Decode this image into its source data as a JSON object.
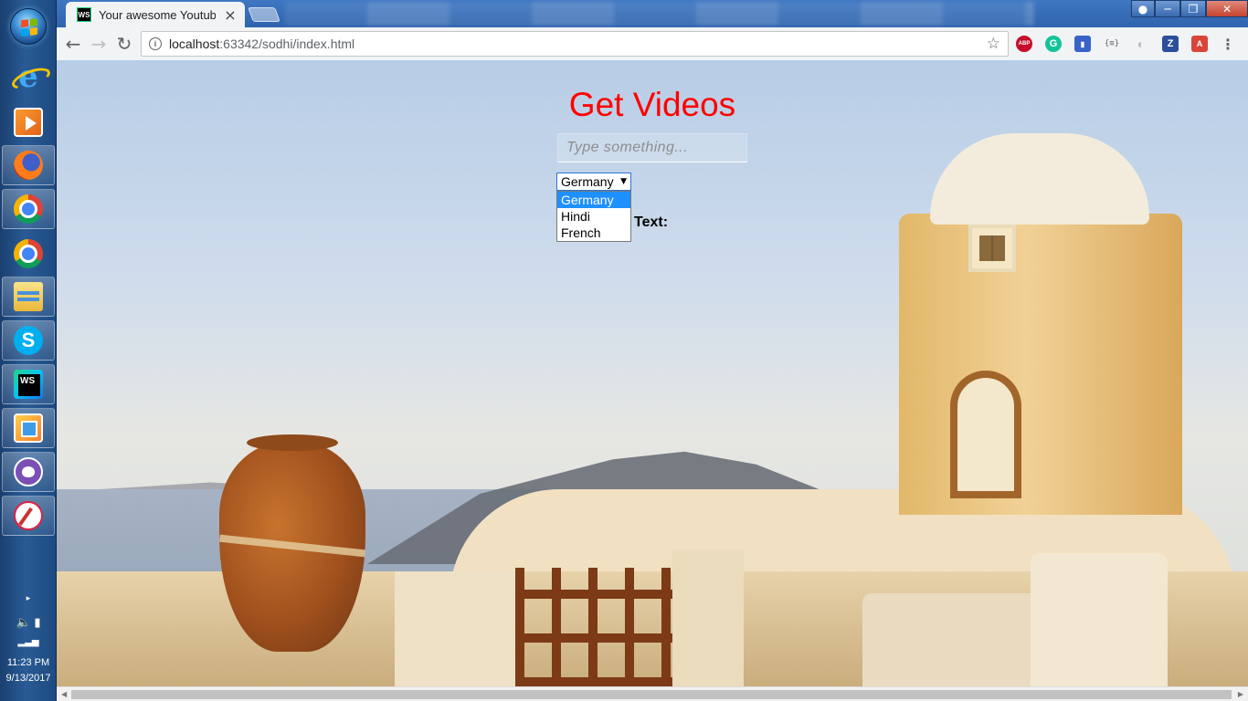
{
  "taskbar": {
    "clock_time": "11:23 PM",
    "clock_date": "9/13/2017"
  },
  "browser": {
    "tab_title": "Your awesome Youtube",
    "tab_favicon_text": "WS",
    "url_host": "localhost",
    "url_rest": ":63342/sodhi/index.html",
    "extensions": [
      "ABP",
      "G",
      "",
      "{≡}",
      "◐",
      "Z",
      "A"
    ]
  },
  "page": {
    "title": "Get Videos",
    "search_placeholder": "Type something...",
    "language_select": {
      "selected": "Germany",
      "options": [
        "Germany",
        "Hindi",
        "French"
      ]
    },
    "text_label": "Text:"
  },
  "colors": {
    "title": "#ff0000",
    "selected_option_bg": "#1e90ff",
    "select_border": "#2f74d6"
  },
  "icons": {
    "taskbar": [
      "windows-start-icon",
      "internet-explorer-icon",
      "media-player-icon",
      "firefox-icon",
      "chrome-icon",
      "chrome-icon",
      "file-explorer-icon",
      "skype-icon",
      "webstorm-icon",
      "photos-icon",
      "cat-app-icon",
      "snipping-tool-icon"
    ]
  }
}
